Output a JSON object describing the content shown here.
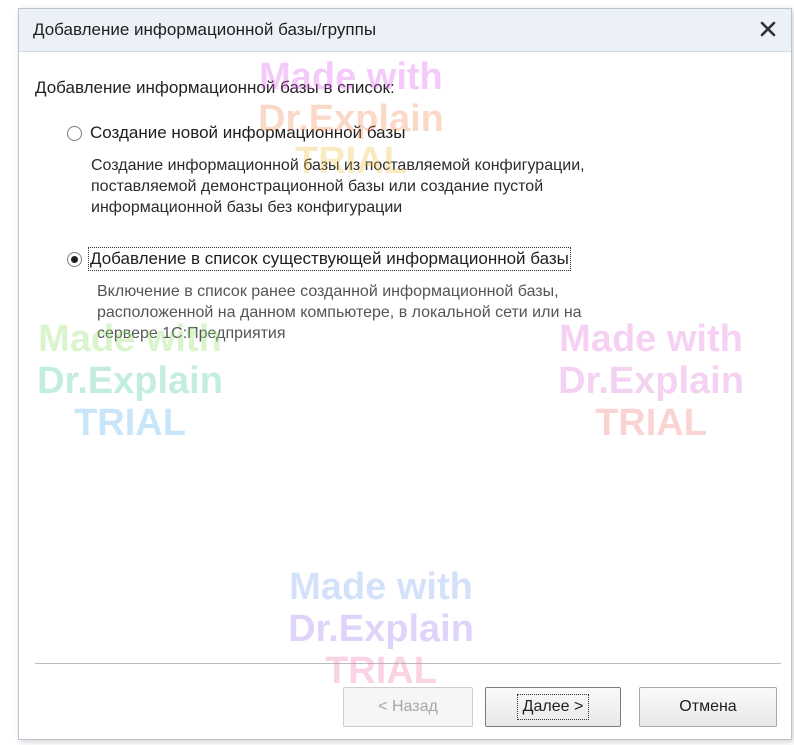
{
  "dialog": {
    "title": "Добавление информационной базы/группы",
    "close_glyph": "✕",
    "intro": "Добавление информационной базы в список:"
  },
  "options": [
    {
      "label": "Создание новой информационной базы",
      "selected": false,
      "description": [
        "Создание информационной базы из поставляемой конфигурации,",
        "поставляемой демонстрационной базы или создание пустой",
        "информационной базы без конфигурации"
      ]
    },
    {
      "label": "Добавление в список существующей информационной базы",
      "selected": true,
      "description": [
        "Включение в список ранее созданной информационной базы,",
        "расположенной на данном компьютере,  в локальной сети или на",
        "сервере 1С:Предприятия"
      ]
    }
  ],
  "buttons": {
    "back": "< Назад",
    "next": "Далее >",
    "cancel": "Отмена"
  },
  "watermark": {
    "line1": "Made with",
    "line2": "Dr.Explain",
    "line3": "TRIAL"
  },
  "colors": {
    "titlebar": "#ecf1f7",
    "window_border": "#b9c4d0"
  }
}
